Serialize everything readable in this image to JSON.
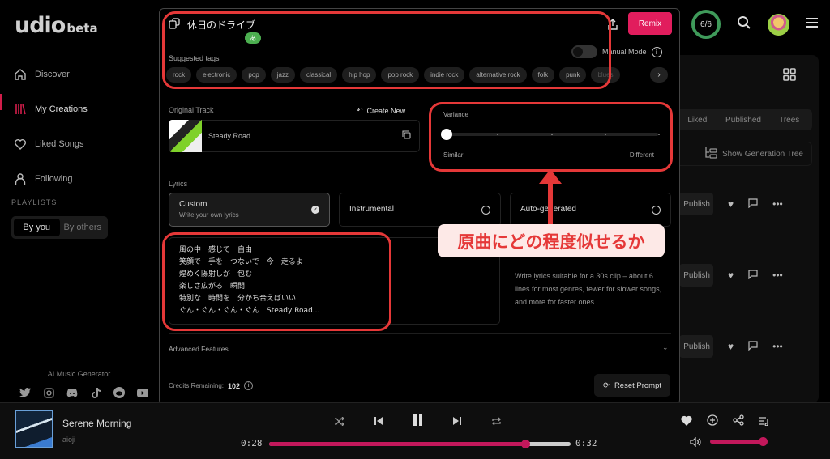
{
  "app": {
    "logo": "udio",
    "logo_suffix": "beta"
  },
  "sidebar": {
    "items": [
      {
        "label": "Discover",
        "icon": "home-icon",
        "active": false
      },
      {
        "label": "My Creations",
        "icon": "library-icon",
        "active": true
      },
      {
        "label": "Liked Songs",
        "icon": "heart-icon",
        "active": false
      },
      {
        "label": "Following",
        "icon": "user-icon",
        "active": false
      }
    ],
    "playlists_label": "PLAYLISTS",
    "playlist_tabs": [
      {
        "label": "By you",
        "selected": true
      },
      {
        "label": "By others",
        "selected": false
      }
    ],
    "footer_label": "AI Music Generator",
    "socials": [
      "twitter-icon",
      "instagram-icon",
      "discord-icon",
      "tiktok-icon",
      "reddit-icon",
      "youtube-icon"
    ]
  },
  "topbar": {
    "credits_ring": "6/6",
    "credits_color": "#3f9a5a"
  },
  "background_page": {
    "tabs": [
      "Liked",
      "Published",
      "Trees"
    ],
    "generation_tree_label": "Show Generation Tree",
    "rows": [
      {
        "publish_label": "Publish"
      },
      {
        "publish_label": "Publish"
      },
      {
        "publish_label": "Publish"
      }
    ]
  },
  "modal": {
    "prompt": "休日のドライブ",
    "ime_badge": "あ",
    "remix_label": "Remix",
    "remix_color": "#e11d5d",
    "suggested_tags_label": "Suggested tags",
    "manual_mode_label": "Manual Mode",
    "manual_mode_on": false,
    "tags": [
      "rock",
      "electronic",
      "pop",
      "jazz",
      "classical",
      "hip hop",
      "pop rock",
      "indie rock",
      "alternative rock",
      "folk",
      "punk",
      "blues"
    ],
    "original_track_label": "Original Track",
    "create_new_label": "Create New",
    "original_track_name": "Steady Road",
    "variance": {
      "label": "Variance",
      "min_label": "Similar",
      "max_label": "Different",
      "value": 0,
      "steps": 5
    },
    "lyrics_label": "Lyrics",
    "lyrics_options": [
      {
        "title": "Custom",
        "subtitle": "Write your own lyrics",
        "selected": true
      },
      {
        "title": "Instrumental",
        "subtitle": "",
        "selected": false
      },
      {
        "title": "Auto-generated",
        "subtitle": "",
        "selected": false
      }
    ],
    "lyrics_text": "風の中　感じて　自由\n笑顔で　手を　つないで　今　走るよ\n煌めく陽射しが　包む\n楽しさ広がる　瞬間\n特別な　時間を　分かち合えばいい\nぐん・ぐん・ぐん・ぐん　Steady Road...",
    "lyrics_hint": "Write lyrics suitable for a 30s clip – about 6 lines for most genres, fewer for slower songs, and more for faster ones.",
    "advanced_label": "Advanced Features",
    "credits_label": "Credits Remaining:",
    "credits_value": "102",
    "reset_label": "Reset Prompt"
  },
  "annotation": {
    "callout_text": "原曲にどの程度似せるか",
    "color": "#e53838"
  },
  "player": {
    "title": "Serene Morning",
    "artist": "aioji",
    "elapsed": "0:28",
    "duration": "0:32",
    "progress_fraction": 0.85,
    "volume_fraction": 1.0,
    "accent": "#c2185b"
  }
}
